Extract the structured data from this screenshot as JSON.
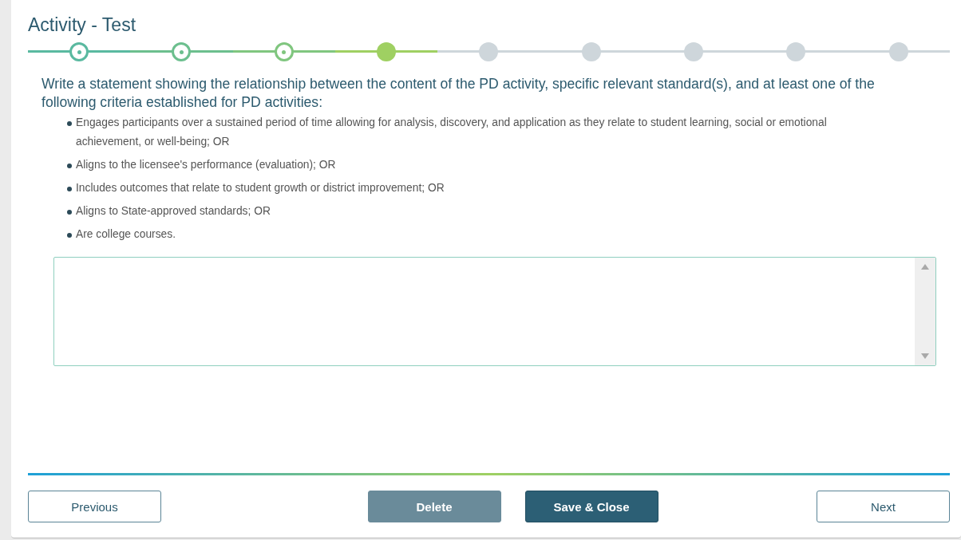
{
  "title": "Activity - Test",
  "steps": [
    {
      "completed": true,
      "current": false
    },
    {
      "completed": true,
      "current": false
    },
    {
      "completed": true,
      "current": false
    },
    {
      "completed": false,
      "current": true
    },
    {
      "completed": false,
      "current": false
    },
    {
      "completed": false,
      "current": false
    },
    {
      "completed": false,
      "current": false
    },
    {
      "completed": false,
      "current": false
    },
    {
      "completed": false,
      "current": false
    }
  ],
  "prompt": "Write a statement showing the relationship between the content of the PD activity, specific relevant standard(s), and at least one of the following criteria established for PD activities:",
  "criteria": [
    "Engages participants over a sustained period of time allowing for analysis, discovery, and application as they relate to student learning, social or emotional achievement, or well-being; OR",
    "Aligns to the licensee's performance (evaluation); OR",
    "Includes outcomes that relate to student growth or district improvement; OR",
    "Aligns to State-approved standards; OR",
    "Are college courses."
  ],
  "buttons": [
    {
      "label": "Previous",
      "kind": "outline",
      "disabled": false
    },
    {
      "label": "Delete",
      "kind": "solid",
      "disabled": true
    },
    {
      "label": "Save & Close",
      "kind": "solid",
      "disabled": false
    },
    {
      "label": "Next",
      "kind": "outline",
      "disabled": false
    }
  ]
}
